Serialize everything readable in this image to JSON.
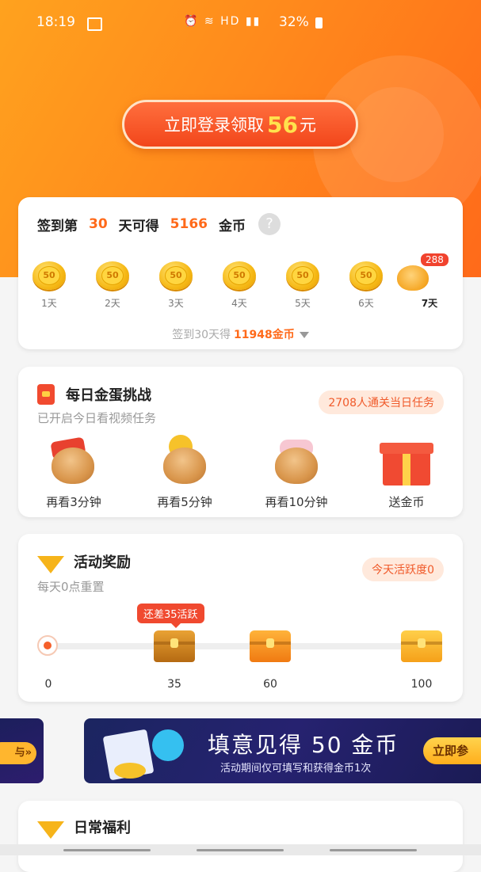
{
  "status_bar": {
    "time": "18:19",
    "network": "HD",
    "battery": "32%"
  },
  "hero": {
    "login_prefix": "立即登录领取",
    "login_amount": "56",
    "login_suffix": "元"
  },
  "signin": {
    "prefix": "签到第",
    "days": "30",
    "middle": "天可得",
    "coins": "5166",
    "unit": "金币",
    "help": "?",
    "coin_value": "50",
    "days_list": [
      "1天",
      "2天",
      "3天",
      "4天",
      "5天",
      "6天",
      "7天"
    ],
    "day7_badge": "288",
    "footer_prefix": "签到30天得",
    "footer_amount": "11948金币"
  },
  "egg_challenge": {
    "title": "每日金蛋挑战",
    "subtitle": "已开启今日看视频任务",
    "pill": "2708人通关当日任务",
    "items": [
      {
        "label": "再看3分钟"
      },
      {
        "label": "再看5分钟"
      },
      {
        "label": "再看10分钟"
      },
      {
        "label": "送金币"
      }
    ]
  },
  "activity": {
    "title": "活动奖励",
    "subtitle": "每天0点重置",
    "pill": "今天活跃度0",
    "tip": "还差35活跃",
    "ticks": [
      "0",
      "35",
      "60",
      "100"
    ]
  },
  "banner": {
    "left_cta": "与»",
    "title": "填意见得 50 金币",
    "subtitle": "活动期间仅可填写和获得金币1次",
    "cta": "立即参"
  },
  "welfare": {
    "title": "日常福利"
  },
  "colors": {
    "accent": "#ff6a1a",
    "hero": "#ff8a1c",
    "red": "#f0492f",
    "gold": "#f6b916"
  }
}
